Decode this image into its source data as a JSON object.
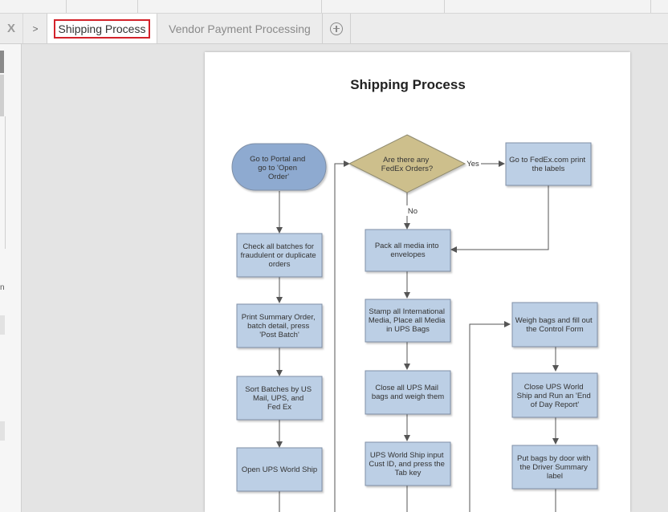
{
  "tabs": {
    "close_label": "X",
    "chevron_label": ">",
    "items": [
      {
        "label": "Shipping Process",
        "active": true
      },
      {
        "label": "Vendor Payment Processing",
        "active": false
      }
    ]
  },
  "left_panel": {
    "fragment": "n"
  },
  "diagram": {
    "title": "Shipping Process",
    "colors": {
      "start": "#8eaad0",
      "process": "#bccfe5",
      "decision": "#cdbf8c",
      "stroke": "#7f8fa6",
      "arrow": "#555555"
    },
    "nodes": [
      {
        "id": "start",
        "lines": [
          "Go to Portal and",
          "go to 'Open",
          "Order'"
        ]
      },
      {
        "id": "check",
        "lines": [
          "Check all batches for",
          "fraudulent or duplicate",
          "orders"
        ]
      },
      {
        "id": "print",
        "lines": [
          "Print Summary Order,",
          "batch detail, press",
          "'Post Batch'"
        ]
      },
      {
        "id": "sort",
        "lines": [
          "Sort Batches by US",
          "Mail, UPS, and",
          "Fed Ex"
        ]
      },
      {
        "id": "openups",
        "lines": [
          "Open UPS World Ship"
        ]
      },
      {
        "id": "decision",
        "lines": [
          "Are there any",
          "FedEx Orders?"
        ]
      },
      {
        "id": "fedex",
        "lines": [
          "Go to FedEx.com print",
          "the labels"
        ]
      },
      {
        "id": "pack",
        "lines": [
          "Pack all media into",
          "envelopes"
        ]
      },
      {
        "id": "stamp",
        "lines": [
          "Stamp all International",
          "Media, Place all Media",
          "in UPS Bags"
        ]
      },
      {
        "id": "close",
        "lines": [
          "Close all UPS  Mail",
          "bags and weigh them"
        ]
      },
      {
        "id": "input",
        "lines": [
          "UPS World Ship input",
          "Cust ID, and press the",
          "Tab key"
        ]
      },
      {
        "id": "weigh",
        "lines": [
          "Weigh bags and fill out",
          "the Control Form"
        ]
      },
      {
        "id": "closeups",
        "lines": [
          "Close UPS World",
          "Ship and Run an 'End",
          "of Day Report'"
        ]
      },
      {
        "id": "door",
        "lines": [
          "Put bags by door with",
          "the Driver Summary",
          "label"
        ]
      }
    ],
    "edge_labels": {
      "yes": "Yes",
      "no": "No"
    }
  }
}
